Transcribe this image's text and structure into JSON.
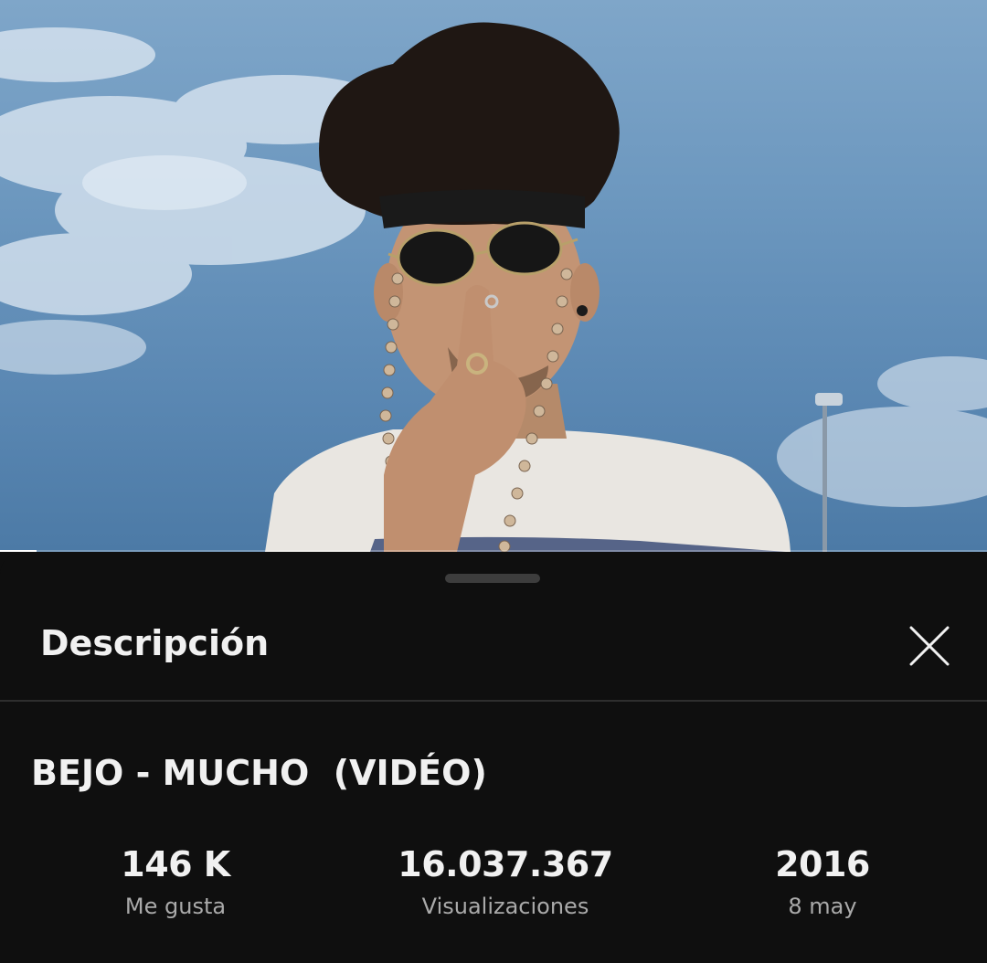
{
  "video": {
    "thumbnail": "video-frame-man-sunglasses-sky",
    "progress": 0.037
  },
  "sheet": {
    "title": "Descripción",
    "close_icon": "close-icon"
  },
  "description": {
    "video_title": "BEJO - MUCHO  (VIDÉO)",
    "stats": [
      {
        "value": "146 K",
        "label": "Me gusta"
      },
      {
        "value": "16.037.367",
        "label": "Visualizaciones"
      },
      {
        "value": "2016",
        "label": "8 may"
      }
    ]
  },
  "colors": {
    "background": "#0f0f0f",
    "text_primary": "#f1f1f1",
    "text_secondary": "#aaaaaa",
    "sky": "#6d98bf"
  }
}
